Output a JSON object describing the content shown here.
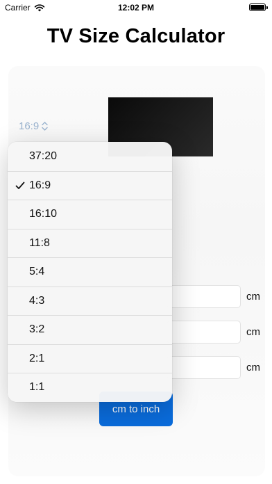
{
  "status_bar": {
    "carrier": "Carrier",
    "time": "12:02 PM"
  },
  "title": "TV Size Calculator",
  "aspect_ratio_select": {
    "value": "16:9"
  },
  "units": [
    "cm",
    "cm",
    "cm"
  ],
  "convert_button_label": "cm to inch",
  "menu": {
    "items": [
      {
        "label": "37:20",
        "selected": false
      },
      {
        "label": "16:9",
        "selected": true
      },
      {
        "label": "16:10",
        "selected": false
      },
      {
        "label": "11:8",
        "selected": false
      },
      {
        "label": "5:4",
        "selected": false
      },
      {
        "label": "4:3",
        "selected": false
      },
      {
        "label": "3:2",
        "selected": false
      },
      {
        "label": "2:1",
        "selected": false
      },
      {
        "label": "1:1",
        "selected": false
      }
    ]
  },
  "colors": {
    "accent": "#0a6cdc",
    "select_text": "#9ab3cf"
  }
}
